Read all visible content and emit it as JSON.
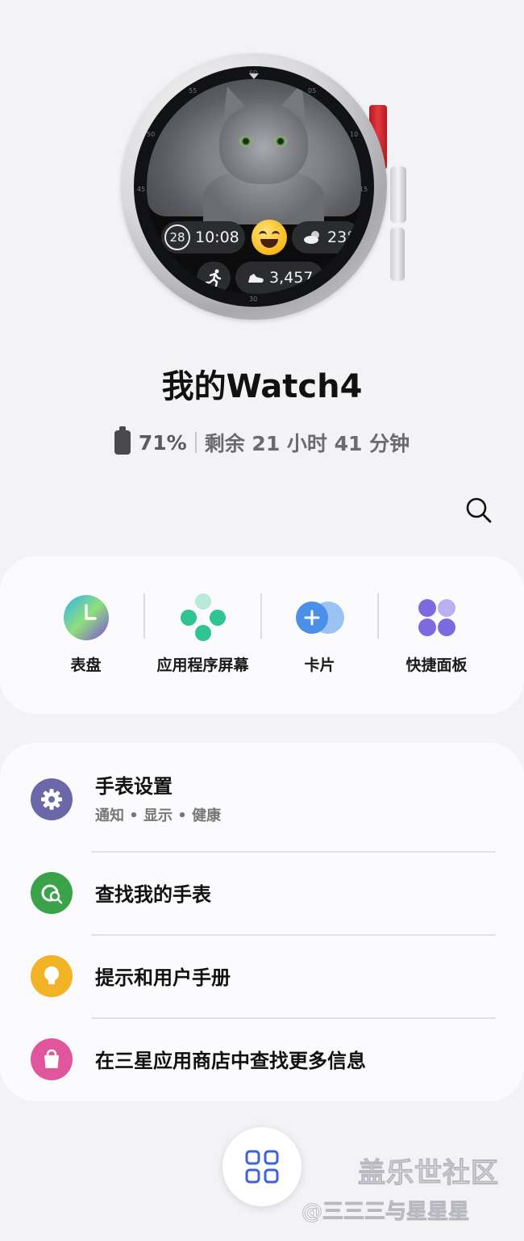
{
  "watch_face": {
    "date": "28",
    "time": "10:08",
    "weather_temp": "23°",
    "steps": "3,457"
  },
  "device": {
    "name": "我的Watch4",
    "battery_percent": "71%",
    "battery_level": 0.71,
    "remaining_time": "剩余 21 小时 41 分钟"
  },
  "shortcuts": [
    {
      "label": "表盘",
      "icon": "watch-face-icon"
    },
    {
      "label": "应用程序屏幕",
      "icon": "apps-screen-icon"
    },
    {
      "label": "卡片",
      "icon": "tiles-icon"
    },
    {
      "label": "快捷面板",
      "icon": "quick-panel-icon"
    }
  ],
  "menu": [
    {
      "title": "手表设置",
      "subtitle": "通知 • 显示 • 健康",
      "icon": "gear-icon",
      "color": "#6b67a8"
    },
    {
      "title": "查找我的手表",
      "icon": "find-watch-icon",
      "color": "#3aa34a"
    },
    {
      "title": "提示和用户手册",
      "icon": "lightbulb-icon",
      "color": "#f2b324"
    },
    {
      "title": "在三星应用商店中查找更多信息",
      "icon": "store-bag-icon",
      "color": "#e0559c"
    }
  ],
  "watermark": {
    "line1": "盖乐世社区",
    "line2": "@三三三与星星星"
  }
}
